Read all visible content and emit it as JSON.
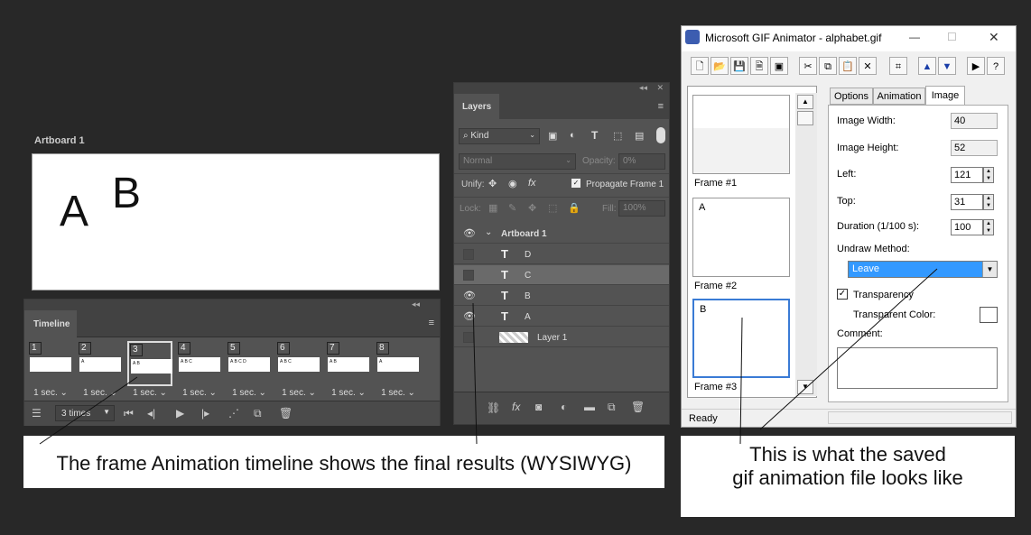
{
  "artboard": {
    "label": "Artboard 1",
    "letters": [
      "A",
      "B"
    ]
  },
  "timeline": {
    "tab": "Timeline",
    "frames": [
      {
        "num": "1",
        "thumb": "",
        "dur": "1 sec."
      },
      {
        "num": "2",
        "thumb": "A",
        "dur": "1 sec."
      },
      {
        "num": "3",
        "thumb": "A B",
        "dur": "1 sec."
      },
      {
        "num": "4",
        "thumb": "A B C",
        "dur": "1 sec."
      },
      {
        "num": "5",
        "thumb": "A B C D",
        "dur": "1 sec."
      },
      {
        "num": "6",
        "thumb": "A B C",
        "dur": "1 sec."
      },
      {
        "num": "7",
        "thumb": "A B",
        "dur": "1 sec."
      },
      {
        "num": "8",
        "thumb": "A",
        "dur": "1 sec."
      }
    ],
    "loop": "3 times",
    "selected_index": 2
  },
  "layers": {
    "tab": "Layers",
    "filter": "Kind",
    "blend": "Normal",
    "opacity_label": "Opacity:",
    "opacity": "0%",
    "unify_label": "Unify:",
    "propagate": "Propagate Frame 1",
    "lock_label": "Lock:",
    "fill_label": "Fill:",
    "fill": "100%",
    "group": "Artboard 1",
    "rows": [
      {
        "name": "D",
        "visible": false,
        "kind": "T"
      },
      {
        "name": "C",
        "visible": false,
        "kind": "T"
      },
      {
        "name": "B",
        "visible": true,
        "kind": "T"
      },
      {
        "name": "A",
        "visible": true,
        "kind": "T"
      },
      {
        "name": "Layer 1",
        "visible": false,
        "kind": "raster"
      }
    ]
  },
  "gif": {
    "title": "Microsoft GIF Animator - alphabet.gif",
    "tabs": [
      "Options",
      "Animation",
      "Image"
    ],
    "active_tab": "Image",
    "frames": [
      {
        "label": "Frame #1",
        "content": ""
      },
      {
        "label": "Frame #2",
        "content": "A"
      },
      {
        "label": "Frame #3",
        "content": "B"
      }
    ],
    "fields": {
      "width_label": "Image Width:",
      "width": "40",
      "height_label": "Image Height:",
      "height": "52",
      "left_label": "Left:",
      "left": "121",
      "top_label": "Top:",
      "top": "31",
      "duration_label": "Duration (1/100 s):",
      "duration": "100",
      "undraw_label": "Undraw Method:",
      "undraw": "Leave",
      "transparency_label": "Transparency",
      "transparent_color_label": "Transparent Color:",
      "comment_label": "Comment:"
    },
    "status": "Ready"
  },
  "captions": {
    "left": "The frame Animation timeline shows the final results (WYSIWYG)",
    "right_line1": "This is what the saved",
    "right_line2": "gif animation file looks like"
  },
  "colors": {
    "selection": "#3399ff",
    "panel": "#535353",
    "bg": "#282828"
  }
}
